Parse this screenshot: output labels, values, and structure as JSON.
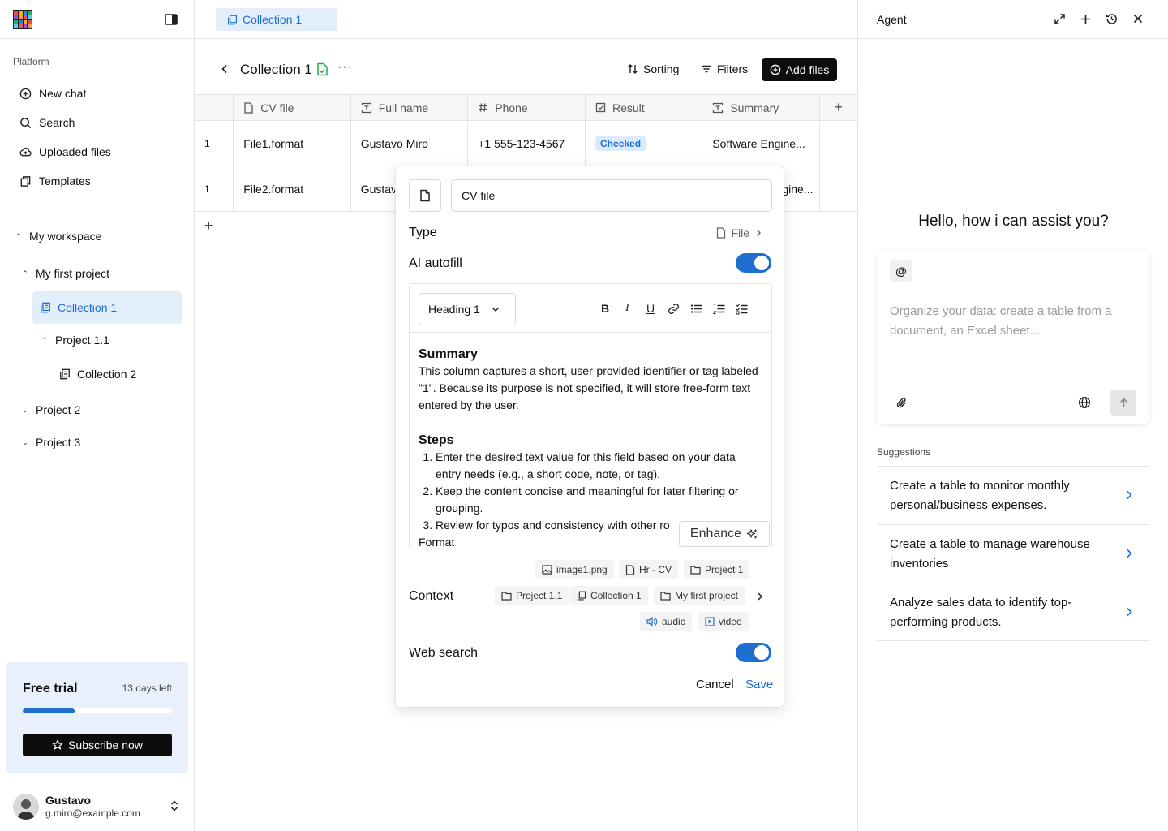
{
  "sidebar": {
    "section_label": "Platform",
    "nav": [
      {
        "label": "New chat",
        "icon": "plus-circle-icon"
      },
      {
        "label": "Search",
        "icon": "search-icon"
      },
      {
        "label": "Uploaded files",
        "icon": "upload-cloud-icon"
      },
      {
        "label": "Templates",
        "icon": "copy-icon"
      }
    ],
    "workspace": "My workspace",
    "tree": {
      "project1": "My first project",
      "collection1": "Collection 1",
      "project11": "Project 1.1",
      "collection2": "Collection 2",
      "project2": "Project 2",
      "project3": "Project 3"
    },
    "trial": {
      "title": "Free trial",
      "days_left": "13 days left",
      "progress": 0.35,
      "subscribe": "Subscribe now"
    },
    "user": {
      "name": "Gustavo",
      "email": "g.miro@example.com"
    }
  },
  "main": {
    "tab": "Collection 1",
    "title": "Collection 1",
    "more": "···",
    "sorting": "Sorting",
    "filters": "Filters",
    "add_files": "Add files",
    "columns": [
      "CV file",
      "Full name",
      "Phone",
      "Result",
      "Summary"
    ],
    "rows": [
      {
        "num": "1",
        "file": "File1.format",
        "name": "Gustavo Miro",
        "phone": "+1 555-123-4567",
        "result": "Checked",
        "summary": "Software Engine..."
      },
      {
        "num": "1",
        "file": "File2.format",
        "name": "Gustav",
        "phone": "",
        "result": "",
        "summary": "gine..."
      }
    ],
    "add_row": "+",
    "add_col": "+"
  },
  "modal": {
    "name_value": "CV file",
    "type_label": "Type",
    "type_value": "File",
    "autofill_label": "AI autofill",
    "autofill_on": true,
    "heading_select": "Heading 1",
    "format_buttons": [
      "B",
      "I",
      "U"
    ],
    "summary_heading": "Summary",
    "summary_text": "This column captures a short, user-provided identifier or tag labeled \"1\". Because its purpose is not specified, it will store free-form text entered by the user.",
    "steps_heading": "Steps",
    "steps": [
      "Enter the desired text value for this field based on your data entry needs (e.g., a short code, note, or tag).",
      "Keep the content concise and meaningful for later filtering or grouping.",
      "Review for typos and consistency with other ro"
    ],
    "format_trail": "Format",
    "enhance": "Enhance",
    "context_label": "Context",
    "context_chips": {
      "image": "image1.png",
      "hr": "Hr - CV",
      "project1": "Project 1",
      "project11": "Project 1.1",
      "collection1": "Collection 1",
      "first_project": "My first project",
      "audio": "audio",
      "video": "video"
    },
    "web_search_label": "Web search",
    "web_search_on": true,
    "cancel": "Cancel",
    "save": "Save"
  },
  "agent": {
    "title": "Agent",
    "greeting": "Hello, how i can assist you?",
    "at": "@",
    "placeholder": "Organize your data: create a table from a document, an Excel sheet...",
    "suggestions_label": "Suggestions",
    "suggestions": [
      "Create a table to monitor monthly personal/business expenses.",
      "Create a table to manage warehouse inventories",
      "Analyze sales data to identify top-performing products."
    ]
  },
  "colors": {
    "accent": "#1f6fd1",
    "accent_bg": "#e3eefb",
    "dark_button": "#0d0d0d",
    "green_icon": "#22a94a"
  }
}
